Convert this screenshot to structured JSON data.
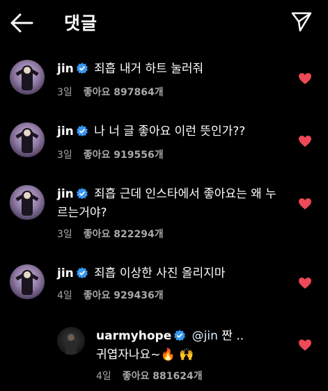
{
  "header": {
    "title": "댓글"
  },
  "colors": {
    "heart": "#ed4956",
    "verified": "#3897f0",
    "meta": "#a8a8a8"
  },
  "comments": [
    {
      "username": "jin",
      "text": "죄흡 내거 하트 눌러줘",
      "time": "3일",
      "likes": "좋아요 897864개"
    },
    {
      "username": "jin",
      "text": "나 너 글 좋아요 이런 뜻인가??",
      "time": "3일",
      "likes": "좋아요 919556개"
    },
    {
      "username": "jin",
      "text": "죄흡 근데 인스타에서 좋아요는 왜 누르는거야?",
      "time": "3일",
      "likes": "좋아요 822294개"
    },
    {
      "username": "jin",
      "text": "죄흡 이상한 사진 올리지마",
      "time": "4일",
      "likes": "좋아요 929436개"
    }
  ],
  "reply": {
    "username": "uarmyhope",
    "mention": "@jin",
    "text": "짠 ..\n귀엽자나요~🔥 🙌",
    "time": "4일",
    "likes": "좋아요 881624개"
  }
}
